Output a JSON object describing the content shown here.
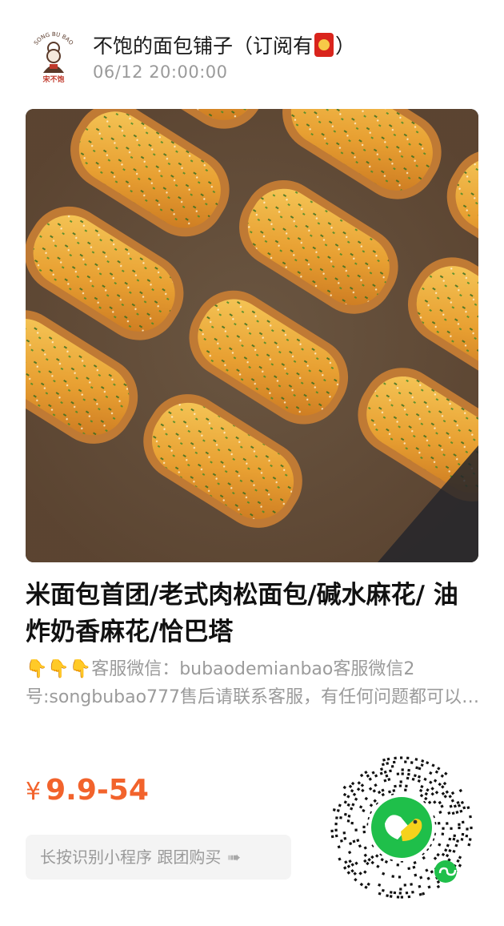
{
  "header": {
    "shop_name_prefix": "不饱的面包铺子（订阅有",
    "shop_name_suffix": "）",
    "avatar_text_top": "SONG BU BAO",
    "avatar_text_bottom": "宋不饱",
    "post_time": "06/12 20:00:00"
  },
  "product": {
    "title": "米面包首团/老式肉松面包/碱水麻花/ 油炸奶香麻花/恰巴塔",
    "description_emoji": "👇👇👇",
    "description": "客服微信：bubaodemianbao客服微信2号:songbubao777售后请联系客服，有任何问题都可以咨询",
    "price_symbol": "¥",
    "price_range": "9.9-54"
  },
  "cta": {
    "label": "长按识别小程序 跟团购买",
    "arrow": "➠"
  },
  "colors": {
    "accent_price": "#f2632c",
    "qr_green": "#1fbf4a",
    "title_text": "#111111",
    "muted_text": "#9b9b9b"
  },
  "icons": {
    "avatar": "bakery-chef-logo",
    "badge": "fu-red-envelope-icon",
    "cta_arrow": "pointing-hand-arrow-icon",
    "qr": "mini-program-qr-code"
  }
}
